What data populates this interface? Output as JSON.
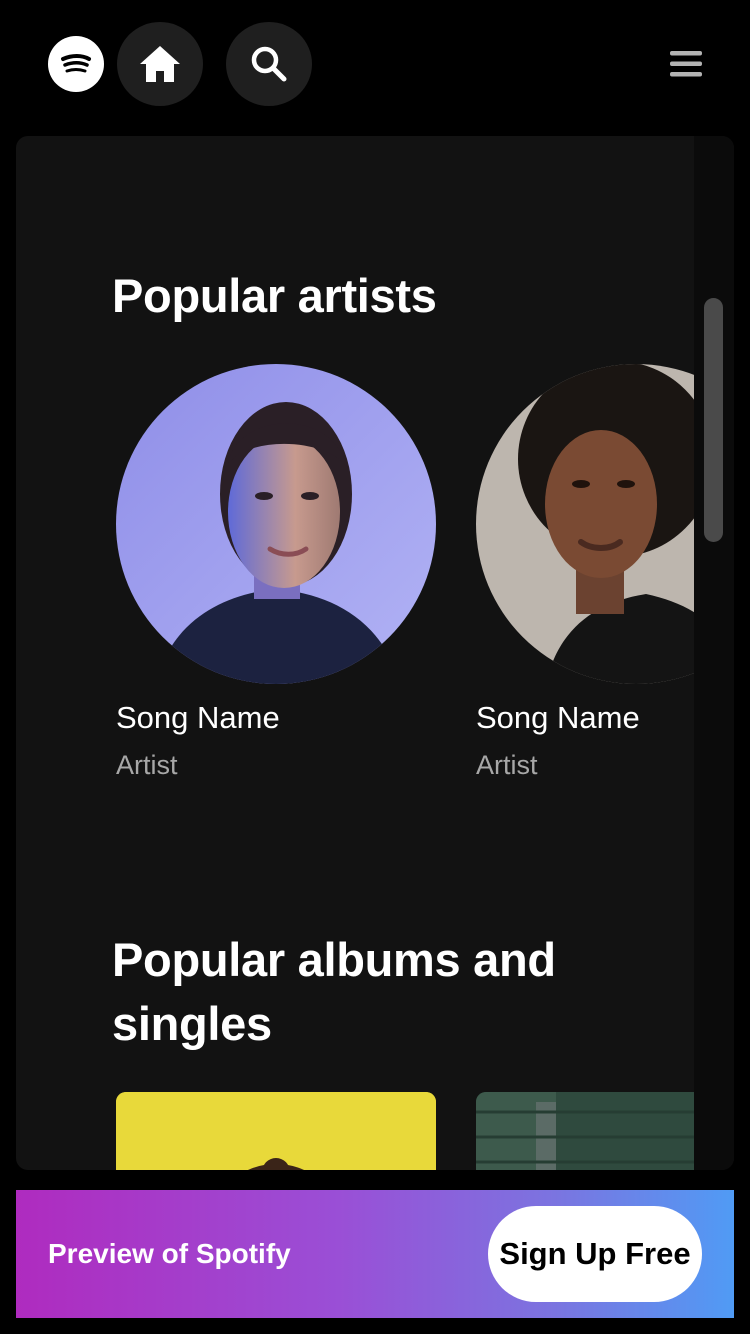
{
  "header": {
    "logo_icon": "spotify-logo-icon",
    "home_icon": "home-icon",
    "search_icon": "search-icon",
    "menu_icon": "hamburger-menu-icon"
  },
  "sections": {
    "artists": {
      "title": "Popular artists",
      "items": [
        {
          "title": "Song Name",
          "subtitle": "Artist"
        },
        {
          "title": "Song Name",
          "subtitle": "Artist"
        }
      ]
    },
    "albums": {
      "title": "Popular albums and singles"
    }
  },
  "banner": {
    "text": "Preview of Spotify",
    "button_label": "Sign Up Free"
  },
  "colors": {
    "background": "#000000",
    "panel": "#121212",
    "secondary_text": "#a7a7a7",
    "banner_start": "#af2bbf",
    "banner_end": "#509bf5"
  }
}
